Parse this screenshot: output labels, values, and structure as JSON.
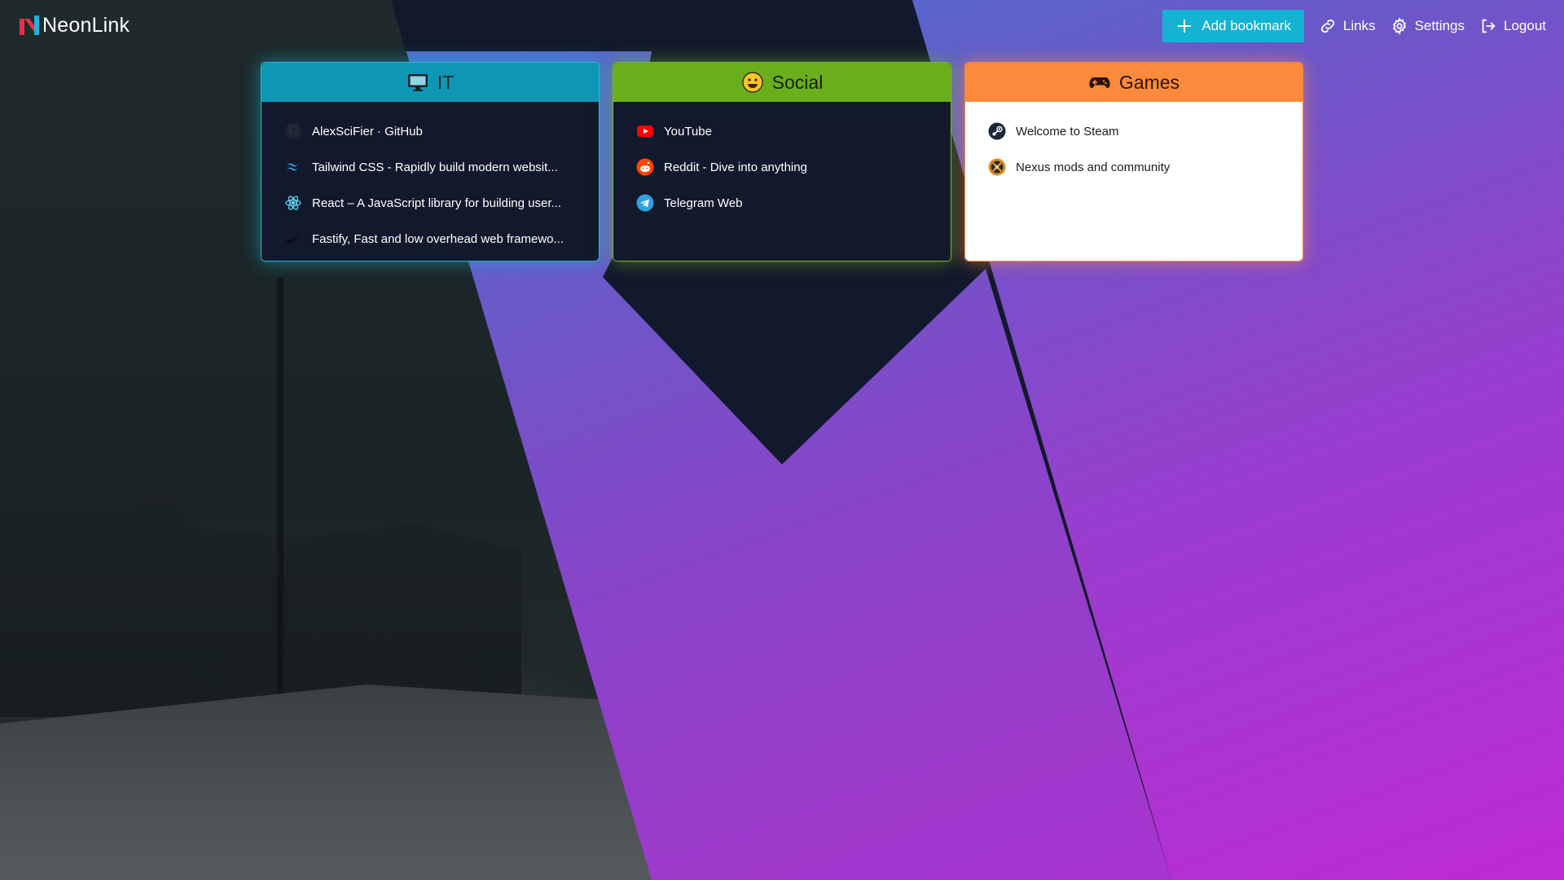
{
  "app": {
    "name": "NeonLink"
  },
  "nav": {
    "add_label": "Add bookmark",
    "links_label": "Links",
    "settings_label": "Settings",
    "logout_label": "Logout"
  },
  "groups": [
    {
      "title": "IT",
      "icon": "monitor-icon",
      "color": "#0e97b5",
      "links": [
        {
          "label": "AlexSciFier · GitHub",
          "icon": "github-icon"
        },
        {
          "label": "Tailwind CSS - Rapidly build modern websit...",
          "icon": "tailwind-icon"
        },
        {
          "label": "React – A JavaScript library for building user...",
          "icon": "react-icon"
        },
        {
          "label": "Fastify, Fast and low overhead web framewo...",
          "icon": "fastify-icon"
        }
      ]
    },
    {
      "title": "Social",
      "icon": "smile-icon",
      "color": "#6aae1c",
      "links": [
        {
          "label": "YouTube",
          "icon": "youtube-icon"
        },
        {
          "label": "Reddit - Dive into anything",
          "icon": "reddit-icon"
        },
        {
          "label": "Telegram Web",
          "icon": "telegram-icon"
        }
      ]
    },
    {
      "title": "Games",
      "icon": "gamepad-icon",
      "color": "#fb8a3c",
      "links": [
        {
          "label": "Welcome to Steam",
          "icon": "steam-icon"
        },
        {
          "label": "Nexus mods and community",
          "icon": "nexus-icon"
        }
      ]
    }
  ],
  "colors": {
    "accent": "#14b3d4",
    "card_bg": "#13192c"
  }
}
